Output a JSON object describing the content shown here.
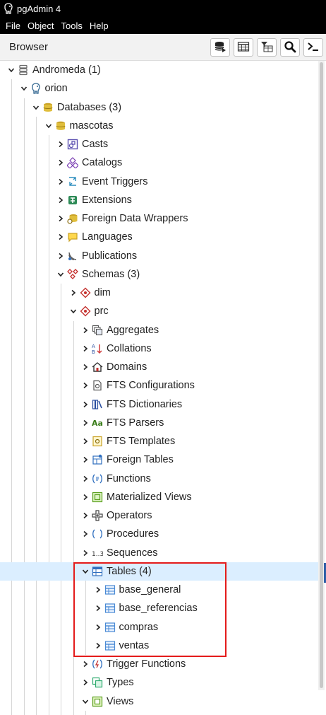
{
  "window": {
    "title": "pgAdmin 4"
  },
  "menu": [
    "File",
    "Object",
    "Tools",
    "Help"
  ],
  "browser": {
    "title": "Browser",
    "toolbar": [
      {
        "name": "object-explorer-icon"
      },
      {
        "name": "view-data-icon"
      },
      {
        "name": "filtered-rows-icon"
      },
      {
        "name": "search-objects-icon"
      },
      {
        "name": "psql-tool-icon"
      }
    ]
  },
  "tree": [
    {
      "label": "Andromeda (1)",
      "level": 0,
      "expanded": true,
      "icon": "server-group-icon"
    },
    {
      "label": "orion",
      "level": 1,
      "expanded": true,
      "icon": "postgres-server-icon"
    },
    {
      "label": "Databases (3)",
      "level": 2,
      "expanded": true,
      "icon": "databases-icon"
    },
    {
      "label": "mascotas",
      "level": 3,
      "expanded": true,
      "icon": "database-icon"
    },
    {
      "label": "Casts",
      "level": 4,
      "expanded": false,
      "icon": "casts-icon"
    },
    {
      "label": "Catalogs",
      "level": 4,
      "expanded": false,
      "icon": "catalogs-icon"
    },
    {
      "label": "Event Triggers",
      "level": 4,
      "expanded": false,
      "icon": "event-triggers-icon"
    },
    {
      "label": "Extensions",
      "level": 4,
      "expanded": false,
      "icon": "extensions-icon"
    },
    {
      "label": "Foreign Data Wrappers",
      "level": 4,
      "expanded": false,
      "icon": "foreign-data-wrappers-icon"
    },
    {
      "label": "Languages",
      "level": 4,
      "expanded": false,
      "icon": "languages-icon"
    },
    {
      "label": "Publications",
      "level": 4,
      "expanded": false,
      "icon": "publications-icon"
    },
    {
      "label": "Schemas (3)",
      "level": 4,
      "expanded": true,
      "icon": "schemas-icon"
    },
    {
      "label": "dim",
      "level": 5,
      "expanded": false,
      "icon": "schema-icon"
    },
    {
      "label": "prc",
      "level": 5,
      "expanded": true,
      "icon": "schema-icon"
    },
    {
      "label": "Aggregates",
      "level": 6,
      "expanded": false,
      "icon": "aggregates-icon"
    },
    {
      "label": "Collations",
      "level": 6,
      "expanded": false,
      "icon": "collations-icon"
    },
    {
      "label": "Domains",
      "level": 6,
      "expanded": false,
      "icon": "domains-icon"
    },
    {
      "label": "FTS Configurations",
      "level": 6,
      "expanded": false,
      "icon": "fts-configurations-icon"
    },
    {
      "label": "FTS Dictionaries",
      "level": 6,
      "expanded": false,
      "icon": "fts-dictionaries-icon"
    },
    {
      "label": "FTS Parsers",
      "level": 6,
      "expanded": false,
      "icon": "fts-parsers-icon"
    },
    {
      "label": "FTS Templates",
      "level": 6,
      "expanded": false,
      "icon": "fts-templates-icon"
    },
    {
      "label": "Foreign Tables",
      "level": 6,
      "expanded": false,
      "icon": "foreign-tables-icon"
    },
    {
      "label": "Functions",
      "level": 6,
      "expanded": false,
      "icon": "functions-icon"
    },
    {
      "label": "Materialized Views",
      "level": 6,
      "expanded": false,
      "icon": "materialized-views-icon"
    },
    {
      "label": "Operators",
      "level": 6,
      "expanded": false,
      "icon": "operators-icon"
    },
    {
      "label": "Procedures",
      "level": 6,
      "expanded": false,
      "icon": "procedures-icon"
    },
    {
      "label": "Sequences",
      "level": 6,
      "expanded": false,
      "icon": "sequences-icon"
    },
    {
      "label": "Tables (4)",
      "level": 6,
      "expanded": true,
      "selected": true,
      "icon": "tables-icon"
    },
    {
      "label": "base_general",
      "level": 7,
      "expanded": false,
      "icon": "table-icon"
    },
    {
      "label": "base_referencias",
      "level": 7,
      "expanded": false,
      "icon": "table-icon"
    },
    {
      "label": "compras",
      "level": 7,
      "expanded": false,
      "icon": "table-icon"
    },
    {
      "label": "ventas",
      "level": 7,
      "expanded": false,
      "icon": "table-icon"
    },
    {
      "label": "Trigger Functions",
      "level": 6,
      "expanded": false,
      "icon": "trigger-functions-icon"
    },
    {
      "label": "Types",
      "level": 6,
      "expanded": false,
      "icon": "types-icon"
    },
    {
      "label": "Views",
      "level": 6,
      "expanded": true,
      "icon": "views-icon"
    }
  ],
  "colors": {
    "selection": "#dbeeff",
    "highlight_box": "#e41b1b",
    "title_bar": "#000000"
  }
}
